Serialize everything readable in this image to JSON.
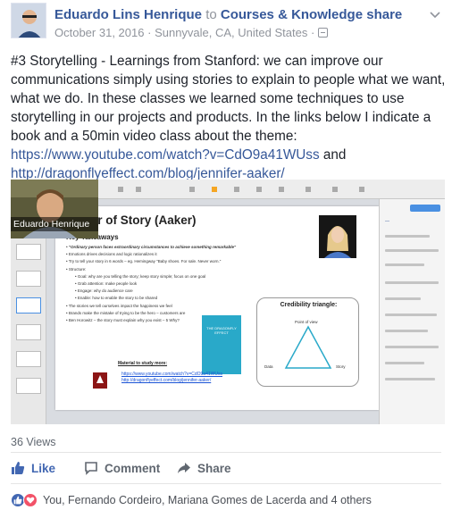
{
  "header": {
    "author": "Eduardo Lins Henrique",
    "connector": "to",
    "group": "Courses & Knowledge share",
    "date": "October 31, 2016",
    "separator": "·",
    "location": "Sunnyvale, CA, United States",
    "separator2": "·",
    "audience_icon": "audience-icon",
    "menu_icon": "chevron-down-icon"
  },
  "post": {
    "text": "#3 Storytelling - Learnings from Stanford: we can improve our communications simply using stories to explain to people what we want, what we do. In these classes we learned some techniques to use storytelling in our projects and products. In the links below I indicate a book and a 50min video class about the theme: ",
    "link1": "https://www.youtube.com/watch?v=CdO9a41WUss",
    "text2": " and ",
    "link2": "http://dragonflyeffect.com/blog/jennifer-aaker/"
  },
  "video": {
    "webcam_name": "Eduardo Henrique",
    "slide": {
      "title": "Power of Story (Aaker)",
      "subtitle": "Key Takeaways",
      "bullets": [
        {
          "text": "\"Ordinary person faces extraordinary circumstances to achieve something remarkable\"",
          "sub": false
        },
        {
          "text": "Emotions drives decisions and logic rationalizes it",
          "sub": false
        },
        {
          "text": "Try to tell your story in 6 words – eg. Hemingway \"Baby shoes. For sale. Never worn.\"",
          "sub": false
        },
        {
          "text": "Structure:",
          "sub": false
        },
        {
          "text": "Goal: why are you telling the story; keep story simple; focus on one goal",
          "sub": true
        },
        {
          "text": "Grab attention: make people look",
          "sub": true
        },
        {
          "text": "Engage: why do audience care",
          "sub": true
        },
        {
          "text": "Enable: how to enable the story to be shared",
          "sub": true
        },
        {
          "text": "The stories we tell ourselves impact the happiness we feel",
          "sub": false
        },
        {
          "text": "Brands make the mistake of trying to be the hero – customers are",
          "sub": false
        },
        {
          "text": "Ben Horowitz – the story must explain why you exist – 5 Why?",
          "sub": false
        }
      ],
      "material_title": "Material to study more:",
      "material_link1": "https://www.youtube.com/watch?v=CdO9a41WUss",
      "material_link2": "http://dragonflyeffect.com/blog/jennifer-aaker/",
      "credibility_title": "Credibility triangle:",
      "credibility_top": "Point of view",
      "credibility_left": "Data",
      "credibility_right": "Story",
      "book_title": "THE DRAGONFLY EFFECT"
    }
  },
  "stats": {
    "views": "36 Views"
  },
  "actions": {
    "like": "Like",
    "comment": "Comment",
    "share": "Share"
  },
  "reactions": {
    "summary": "You, Fernando Cordeiro, Mariana Gomes de Lacerda and 4 others"
  },
  "colors": {
    "link": "#365899",
    "like_blue": "#4267b2",
    "love_red": "#f25268",
    "muted": "#90949c"
  }
}
